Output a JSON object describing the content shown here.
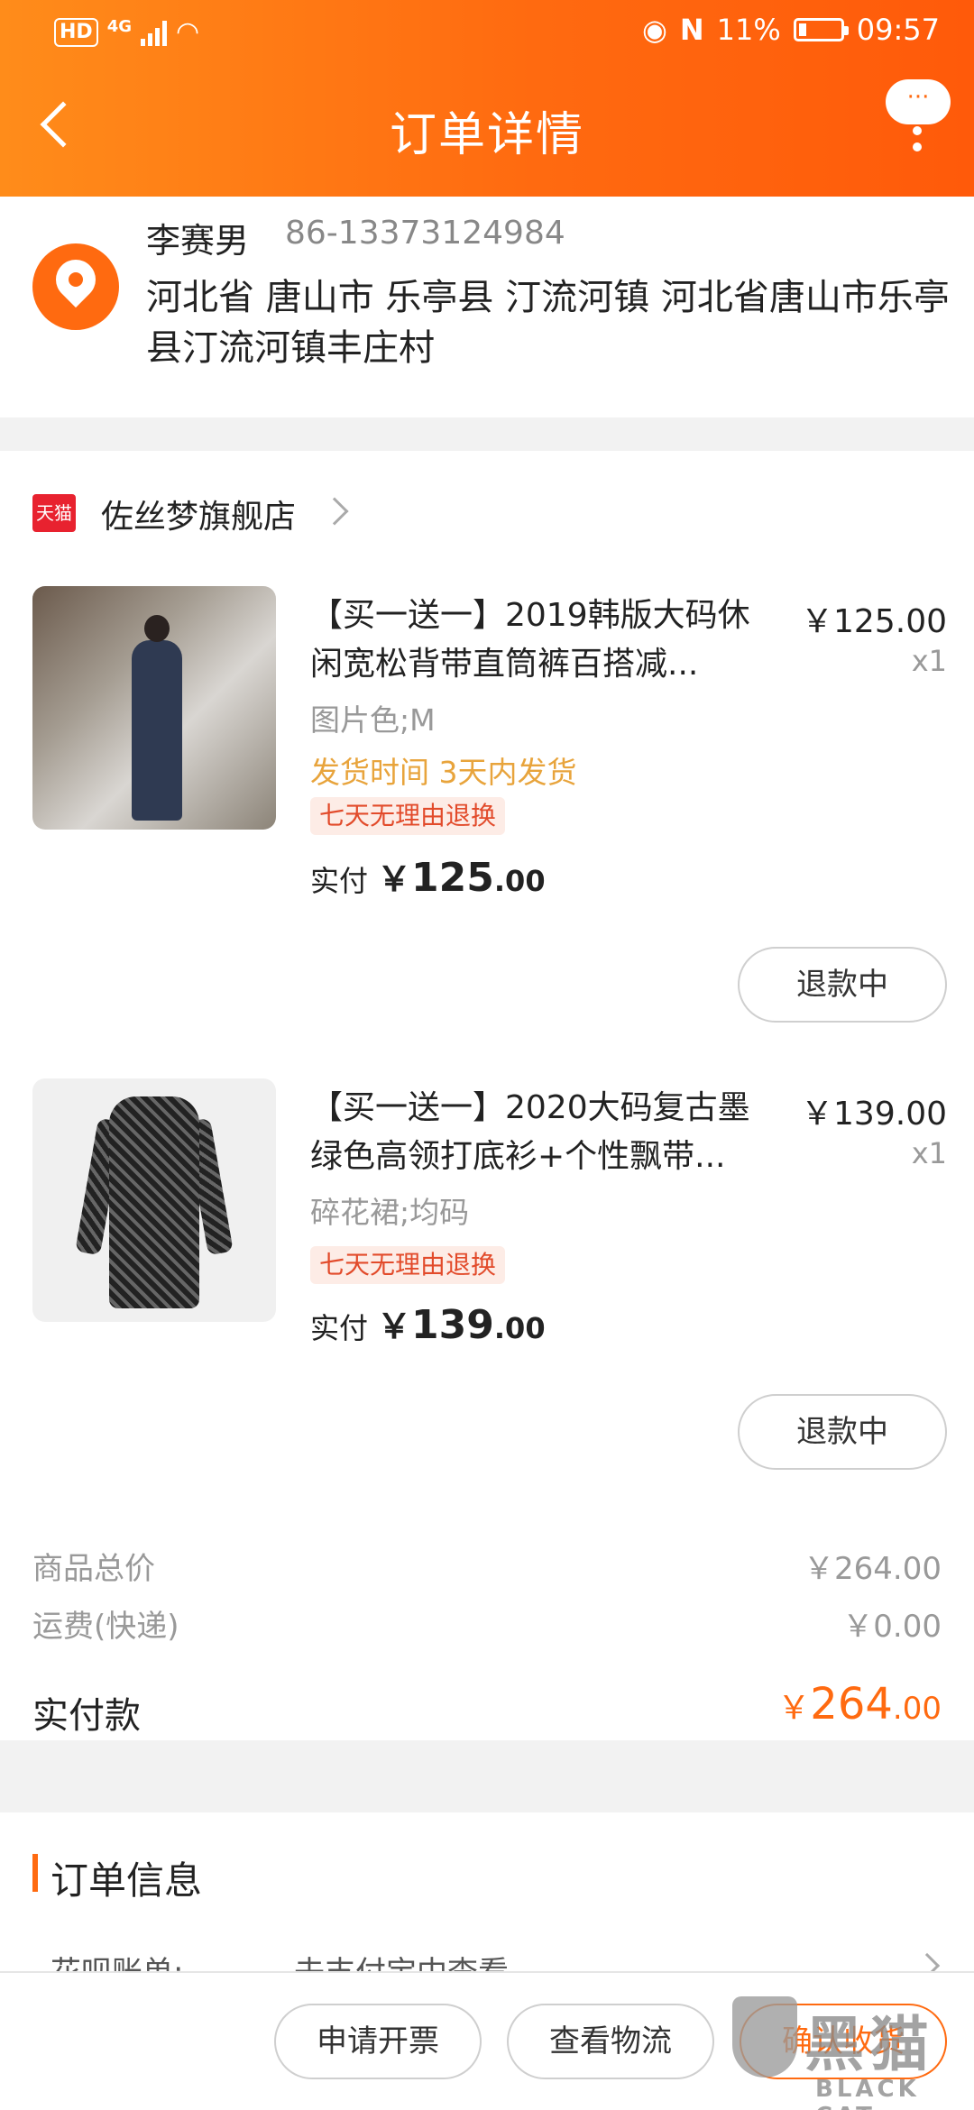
{
  "status_bar": {
    "hd": "HD",
    "network": "4G",
    "battery_percent": "11%",
    "time": "09:57"
  },
  "nav": {
    "title": "订单详情",
    "more_bubble": "···"
  },
  "address": {
    "name": "李赛男",
    "phone": "86-13373124984",
    "detail": "河北省 唐山市 乐亭县 汀流河镇 河北省唐山市乐亭县汀流河镇丰庄村"
  },
  "store": {
    "badge": "天猫",
    "name": "佐丝梦旗舰店"
  },
  "products": [
    {
      "title": "【买一送一】2019韩版大码休闲宽松背带直筒裤百搭减...",
      "price": "￥125.00",
      "qty": "x1",
      "spec": "图片色;M",
      "shipping": "发货时间 3天内发货",
      "tag": "七天无理由退换",
      "paid_label": "实付",
      "paid_currency": "￥",
      "paid_int": "125",
      "paid_dec": ".00",
      "refund_label": "退款中"
    },
    {
      "title": "【买一送一】2020大码复古墨绿色高领打底衫+个性飘带...",
      "price": "￥139.00",
      "qty": "x1",
      "spec": "碎花裙;均码",
      "tag": "七天无理由退换",
      "paid_label": "实付",
      "paid_currency": "￥",
      "paid_int": "139",
      "paid_dec": ".00",
      "refund_label": "退款中"
    }
  ],
  "summary": {
    "goods_total_label": "商品总价",
    "goods_total_value": "￥264.00",
    "shipping_label": "运费(快递)",
    "shipping_value": "￥0.00",
    "paid_label": "实付款",
    "paid_currency": "￥",
    "paid_int": "264",
    "paid_dec": ".00"
  },
  "order_info": {
    "title": "订单信息",
    "row_label": "花呗账单:",
    "row_value": "去支付宝中查看"
  },
  "actions": {
    "invoice": "申请开票",
    "logistics": "查看物流",
    "confirm": "确认收货"
  },
  "watermark": {
    "cn": "黑猫",
    "en": "BLACK CAT"
  },
  "colors": {
    "accent": "#ff6a10",
    "tmall_red": "#e8222f",
    "ship_time": "#e8a43c"
  }
}
